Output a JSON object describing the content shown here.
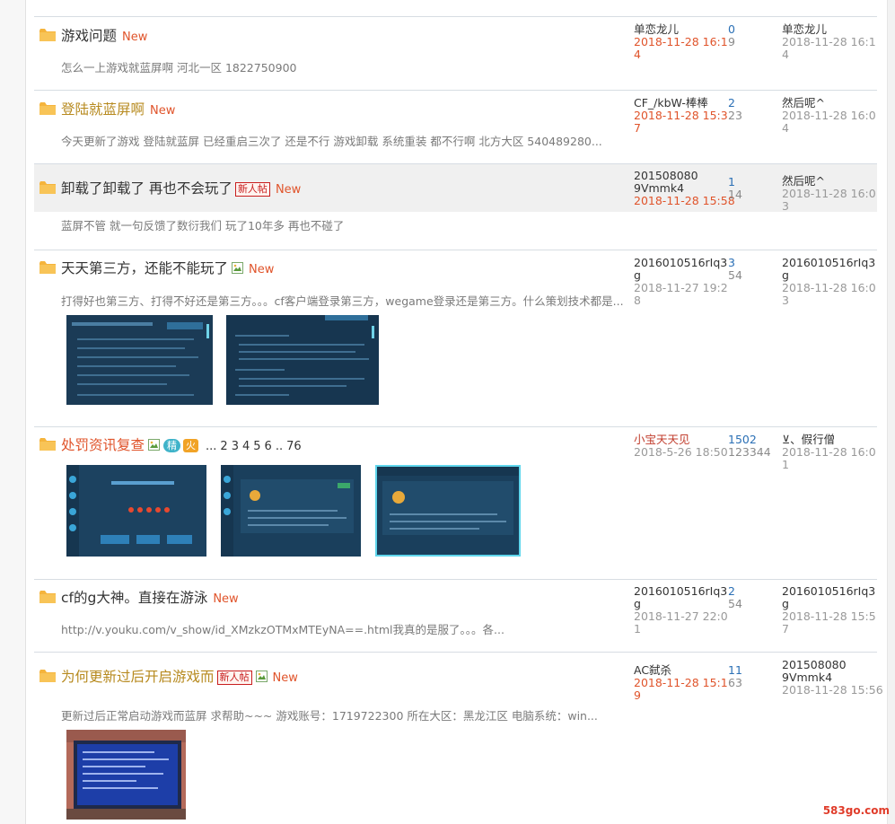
{
  "threads": [
    {
      "title": "游戏问题",
      "new_label": "New",
      "excerpt": "怎么一上游戏就蓝屏啊 河北一区 1822750900",
      "author": "单恋龙儿",
      "date": "2018-11-28 16:14",
      "replies": "0",
      "views": "9",
      "last_user": "单恋龙儿",
      "last_date": "2018-11-28 16:14"
    },
    {
      "title": "登陆就蓝屏啊",
      "new_label": "New",
      "excerpt": "今天更新了游戏 登陆就蓝屏 已经重启三次了 还是不行 游戏卸载 系统重装 都不行啊 北方大区 540489280...",
      "author": "CF_/kbW-棒棒",
      "date": "2018-11-28 15:37",
      "replies": "2",
      "views": "23",
      "last_user": "然后呢^",
      "last_date": "2018-11-28 16:04"
    },
    {
      "title": "卸载了卸载了 再也不会玩了",
      "badge": "新人帖",
      "new_label": "New",
      "excerpt": "蓝屏不管 就一句反馈了数衍我们 玩了10年多 再也不碰了",
      "author": "2015080809Vmmk4",
      "date": "2018-11-28 15:58",
      "replies": "1",
      "views": "14",
      "last_user": "然后呢^",
      "last_date": "2018-11-28 16:03"
    },
    {
      "title": "天天第三方，还能不能玩了",
      "new_label": "New",
      "excerpt": "打得好也第三方、打得不好还是第三方。。。cf客户端登录第三方，wegame登录还是第三方。什么策划技术都是...",
      "author": "2016010516rIq3g",
      "date": "2018-11-27 19:28",
      "replies": "3",
      "views": "54",
      "last_user": "2016010516rIq3g",
      "last_date": "2018-11-28 16:03"
    },
    {
      "title": "处罚资讯复查",
      "jing": "精",
      "huo": "火",
      "pager": [
        "...",
        "2",
        "3",
        "4",
        "5",
        "6",
        "..",
        "76"
      ],
      "author": "小宝天天见",
      "date": "2018-5-26 18:50",
      "replies": "1502",
      "views": "123344",
      "last_user": "⊻、假行僧",
      "last_date": "2018-11-28 16:01"
    },
    {
      "title": "cf的g大神。直接在游泳",
      "new_label": "New",
      "excerpt": "http://v.youku.com/v_show/id_XMzkzOTMxMTEyNA==.html我真的是服了。。。各...",
      "author": "2016010516rIq3g",
      "date": "2018-11-27 22:01",
      "replies": "2",
      "views": "54",
      "last_user": "2016010516rIq3g",
      "last_date": "2018-11-28 15:57"
    },
    {
      "title": "为何更新过后开启游戏而",
      "badge": "新人帖",
      "new_label": "New",
      "excerpt": "更新过后正常启动游戏而蓝屏 求帮助~~~ 游戏账号：1719722300 所在大区：黑龙江区 电脑系统：win...",
      "author": "AC弑杀",
      "date": "2018-11-28 15:19",
      "replies": "11",
      "views": "63",
      "last_user": "2015080809Vmmk4",
      "last_date": "2018-11-28 15:56"
    }
  ],
  "watermark": "583go.com",
  "colors": {
    "folder": "#f5b43c",
    "new": "#e0542b",
    "link_gold": "#b78a1f",
    "reply_blue": "#2a6fb5",
    "thumb_bg": "#1b3b56"
  }
}
